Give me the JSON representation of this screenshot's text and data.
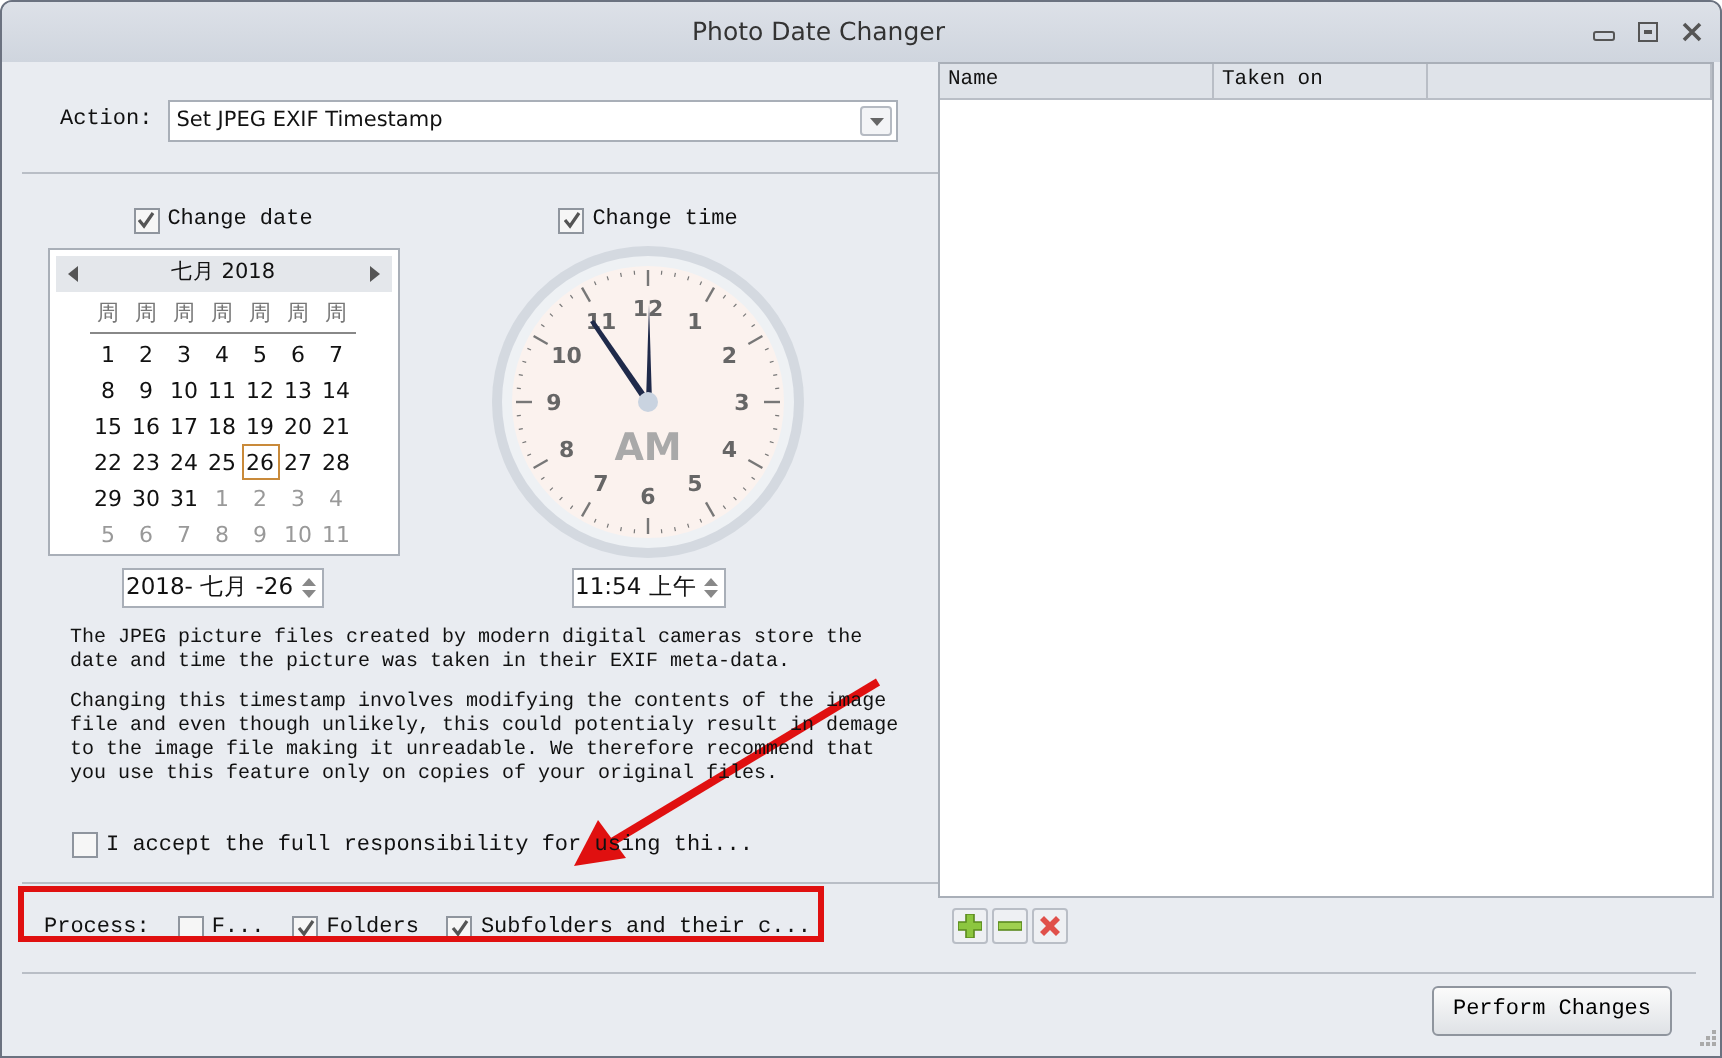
{
  "window": {
    "title": "Photo Date Changer"
  },
  "action": {
    "label": "Action:",
    "value": "Set JPEG EXIF Timestamp"
  },
  "change_date": {
    "label": "Change date",
    "checked": true
  },
  "change_time": {
    "label": "Change time",
    "checked": true
  },
  "calendar": {
    "month": "七月 2018",
    "weekdays": [
      "周",
      "周",
      "周",
      "周",
      "周",
      "周",
      "周"
    ],
    "days": [
      {
        "text": "1",
        "in_month": true,
        "selected": false
      },
      {
        "text": "2",
        "in_month": true,
        "selected": false
      },
      {
        "text": "3",
        "in_month": true,
        "selected": false
      },
      {
        "text": "4",
        "in_month": true,
        "selected": false
      },
      {
        "text": "5",
        "in_month": true,
        "selected": false
      },
      {
        "text": "6",
        "in_month": true,
        "selected": false
      },
      {
        "text": "7",
        "in_month": true,
        "selected": false
      },
      {
        "text": "8",
        "in_month": true,
        "selected": false
      },
      {
        "text": "9",
        "in_month": true,
        "selected": false
      },
      {
        "text": "10",
        "in_month": true,
        "selected": false
      },
      {
        "text": "11",
        "in_month": true,
        "selected": false
      },
      {
        "text": "12",
        "in_month": true,
        "selected": false
      },
      {
        "text": "13",
        "in_month": true,
        "selected": false
      },
      {
        "text": "14",
        "in_month": true,
        "selected": false
      },
      {
        "text": "15",
        "in_month": true,
        "selected": false
      },
      {
        "text": "16",
        "in_month": true,
        "selected": false
      },
      {
        "text": "17",
        "in_month": true,
        "selected": false
      },
      {
        "text": "18",
        "in_month": true,
        "selected": false
      },
      {
        "text": "19",
        "in_month": true,
        "selected": false
      },
      {
        "text": "20",
        "in_month": true,
        "selected": false
      },
      {
        "text": "21",
        "in_month": true,
        "selected": false
      },
      {
        "text": "22",
        "in_month": true,
        "selected": false
      },
      {
        "text": "23",
        "in_month": true,
        "selected": false
      },
      {
        "text": "24",
        "in_month": true,
        "selected": false
      },
      {
        "text": "25",
        "in_month": true,
        "selected": false
      },
      {
        "text": "26",
        "in_month": true,
        "selected": true
      },
      {
        "text": "27",
        "in_month": true,
        "selected": false
      },
      {
        "text": "28",
        "in_month": true,
        "selected": false
      },
      {
        "text": "29",
        "in_month": true,
        "selected": false
      },
      {
        "text": "30",
        "in_month": true,
        "selected": false
      },
      {
        "text": "31",
        "in_month": true,
        "selected": false
      },
      {
        "text": "1",
        "in_month": false,
        "selected": false
      },
      {
        "text": "2",
        "in_month": false,
        "selected": false
      },
      {
        "text": "3",
        "in_month": false,
        "selected": false
      },
      {
        "text": "4",
        "in_month": false,
        "selected": false
      },
      {
        "text": "5",
        "in_month": false,
        "selected": false
      },
      {
        "text": "6",
        "in_month": false,
        "selected": false
      },
      {
        "text": "7",
        "in_month": false,
        "selected": false
      },
      {
        "text": "8",
        "in_month": false,
        "selected": false
      },
      {
        "text": "9",
        "in_month": false,
        "selected": false
      },
      {
        "text": "10",
        "in_month": false,
        "selected": false
      },
      {
        "text": "11",
        "in_month": false,
        "selected": false
      }
    ]
  },
  "clock": {
    "numbers": [
      "12",
      "1",
      "2",
      "3",
      "4",
      "5",
      "6",
      "7",
      "8",
      "9",
      "10",
      "11"
    ],
    "period": "AM"
  },
  "date_field": {
    "value": "2018- 七月 -26"
  },
  "time_field": {
    "value": "11:54 上午"
  },
  "description": [
    "The JPEG picture files created by modern digital cameras store the date and time the picture was taken in their EXIF meta-data.",
    "Changing this timestamp involves modifying the contents of the image file and even though unlikely, this could potentialy result in demage to the image file making it unreadable. We therefore recommend that you use this feature only on copies of your original files."
  ],
  "accept": {
    "label": "I accept the full responsibility for using thi...",
    "checked": false
  },
  "process": {
    "label": "Process:",
    "options": [
      {
        "label": "F...",
        "checked": false
      },
      {
        "label": "Folders",
        "checked": true
      },
      {
        "label": "Subfolders and their c...",
        "checked": true
      }
    ]
  },
  "file_list": {
    "columns": [
      "Name",
      "Taken on"
    ]
  },
  "toolbar": [
    {
      "kind": "add"
    },
    {
      "kind": "remove"
    },
    {
      "kind": "clear"
    }
  ],
  "perform_button": "Perform Changes",
  "annotations": {
    "frame": true,
    "arrow": true
  }
}
